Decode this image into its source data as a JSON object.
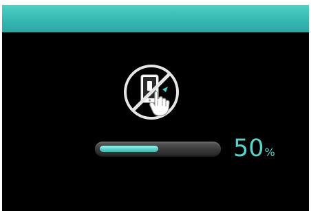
{
  "progress": {
    "value": 50,
    "value_text": "50",
    "unit": "%"
  },
  "icon": {
    "name": "no-touch-icon"
  },
  "colors": {
    "accent": "#5fd0ca",
    "title_bar": "#36b7b1",
    "background": "#000000"
  }
}
